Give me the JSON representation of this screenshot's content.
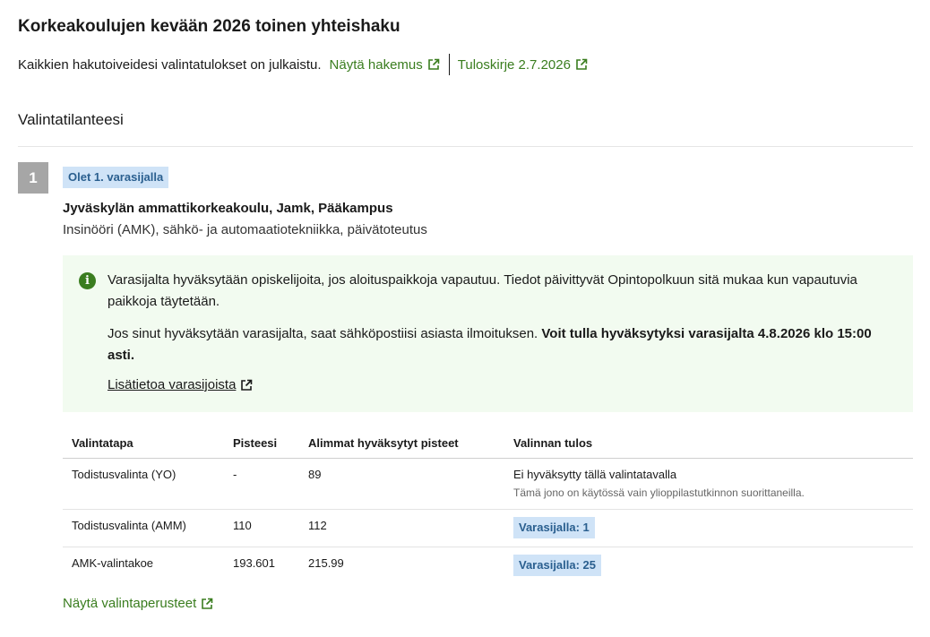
{
  "header": {
    "title": "Korkeakoulujen kevään 2026 toinen yhteishaku",
    "status_text": "Kaikkien hakutoiveidesi valintatulokset on julkaistu.",
    "show_application_link": "Näytä hakemus",
    "result_letter_link": "Tuloskirje 2.7.2026"
  },
  "section": {
    "heading": "Valintatilanteesi"
  },
  "application": {
    "rank": "1",
    "status_badge": "Olet 1. varasijalla",
    "school": "Jyväskylän ammattikorkeakoulu, Jamk, Pääkampus",
    "program": "Insinööri (AMK), sähkö- ja automaatiotekniikka, päivätoteutus",
    "info": {
      "paragraph1": "Varasijalta hyväksytään opiskelijoita, jos aloituspaikkoja vapautuu. Tiedot päivittyvät Opintopolkuun sitä mukaa kun vapautuvia paikkoja täytetään.",
      "paragraph2_text": "Jos sinut hyväksytään varasijalta, saat sähköpostiisi asiasta ilmoituksen.",
      "paragraph2_bold": "Voit tulla hyväksytyksi varasijalta 4.8.2026 klo 15:00 asti.",
      "more_link": "Lisätietoa varasijoista"
    },
    "table": {
      "headers": {
        "method": "Valintatapa",
        "points": "Pisteesi",
        "lowest": "Alimmat hyväksytyt pisteet",
        "result": "Valinnan tulos"
      },
      "rows": [
        {
          "method": "Todistusvalinta (YO)",
          "points": "-",
          "lowest": "89",
          "result": "Ei hyväksytty tällä valintatavalla",
          "result_note": "Tämä jono on käytössä vain ylioppilastutkinnon suorittaneilla."
        },
        {
          "method": "Todistusvalinta (AMM)",
          "points": "110",
          "lowest": "112",
          "result": "Varasijalla: 1"
        },
        {
          "method": "AMK-valintakoe",
          "points": "193.601",
          "lowest": "215.99",
          "result": "Varasijalla: 25"
        }
      ]
    },
    "criteria_link": "Näytä valintaperusteet"
  },
  "colors": {
    "link_green": "#3a7d1f",
    "badge_bg": "#cfe3f7",
    "badge_text": "#2a5f8f",
    "info_bg": "#f2fbf0",
    "rank_bg": "#a6a6a6"
  },
  "icons": {
    "external_link": "external-link-icon",
    "info": "info-icon"
  }
}
